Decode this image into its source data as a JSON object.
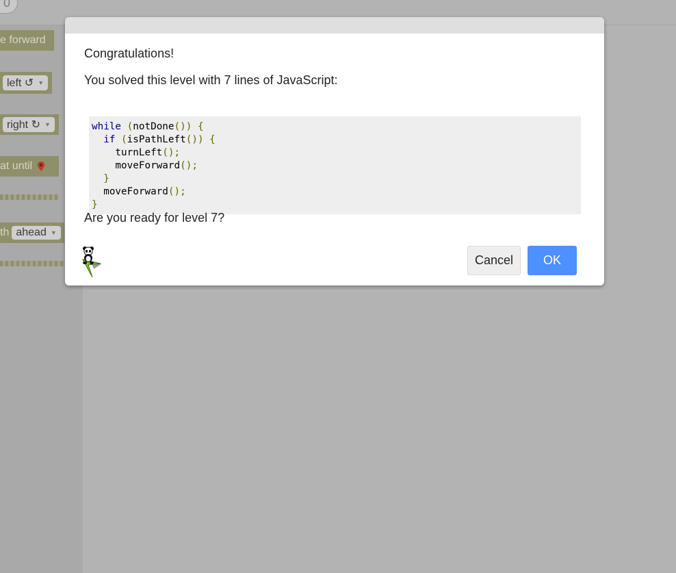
{
  "background": {
    "run_counter": "0",
    "blocks": {
      "move_forward": "e forward",
      "turn_left": "left ↺",
      "turn_right": "right ↻",
      "repeat_until": "at until",
      "if_path_prefix": "th",
      "if_path_dropdown": "ahead"
    }
  },
  "dialog": {
    "title": "Congratulations!",
    "message": "You solved this level with 7 lines of JavaScript:",
    "code_lines": [
      [
        {
          "t": "while",
          "c": "kw"
        },
        {
          "t": " ",
          "c": "pl"
        },
        {
          "t": "(",
          "c": "pn"
        },
        {
          "t": "notDone",
          "c": "pl"
        },
        {
          "t": "())",
          "c": "pn"
        },
        {
          "t": " ",
          "c": "pl"
        },
        {
          "t": "{",
          "c": "pn"
        }
      ],
      [
        {
          "t": "  ",
          "c": "pl"
        },
        {
          "t": "if",
          "c": "kw"
        },
        {
          "t": " ",
          "c": "pl"
        },
        {
          "t": "(",
          "c": "pn"
        },
        {
          "t": "isPathLeft",
          "c": "pl"
        },
        {
          "t": "())",
          "c": "pn"
        },
        {
          "t": " ",
          "c": "pl"
        },
        {
          "t": "{",
          "c": "pn"
        }
      ],
      [
        {
          "t": "    turnLeft",
          "c": "pl"
        },
        {
          "t": "();",
          "c": "pn"
        }
      ],
      [
        {
          "t": "    moveForward",
          "c": "pl"
        },
        {
          "t": "();",
          "c": "pn"
        }
      ],
      [
        {
          "t": "  ",
          "c": "pl"
        },
        {
          "t": "}",
          "c": "pn"
        }
      ],
      [
        {
          "t": "  moveForward",
          "c": "pl"
        },
        {
          "t": "();",
          "c": "pn"
        }
      ],
      [
        {
          "t": "}",
          "c": "pn"
        }
      ]
    ],
    "question": "Are you ready for level 7?",
    "cancel_label": "Cancel",
    "ok_label": "OK",
    "colors": {
      "ok_button": "#4d90fe",
      "keyword": "#000088",
      "punctuation": "#666600"
    }
  }
}
